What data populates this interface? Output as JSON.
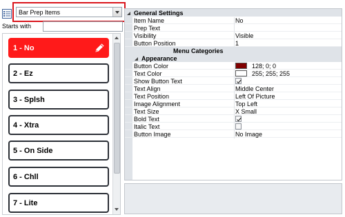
{
  "dropdown": {
    "value": "Bar Prep Items"
  },
  "search": {
    "label": "Starts with",
    "value": ""
  },
  "items": [
    {
      "label": "1 - No",
      "selected": true
    },
    {
      "label": "2 - Ez",
      "selected": false
    },
    {
      "label": "3 - Splsh",
      "selected": false
    },
    {
      "label": "4 - Xtra",
      "selected": false
    },
    {
      "label": "5 - On Side",
      "selected": false
    },
    {
      "label": "6 - Chll",
      "selected": false
    },
    {
      "label": "7 - Lite",
      "selected": false
    }
  ],
  "properties": {
    "general_settings": "General Settings",
    "item_name": {
      "name": "Item Name",
      "value": "No"
    },
    "prep_text": {
      "name": "Prep Text",
      "value": ""
    },
    "visibility": {
      "name": "Visibility",
      "value": "Visible"
    },
    "button_position": {
      "name": "Button Position",
      "value": "1"
    },
    "menu_categories": "Menu Categories",
    "appearance": "Appearance",
    "button_color": {
      "name": "Button Color",
      "value": "128; 0; 0",
      "swatch": "#800000"
    },
    "text_color": {
      "name": "Text Color",
      "value": "255; 255; 255",
      "swatch": "#ffffff"
    },
    "show_button_text": {
      "name": "Show Button Text",
      "checked": true
    },
    "text_align": {
      "name": "Text Align",
      "value": "Middle Center"
    },
    "text_position": {
      "name": "Text Position",
      "value": "Left Of Picture"
    },
    "image_alignment": {
      "name": "Image Alignment",
      "value": "Top Left"
    },
    "text_size": {
      "name": "Text Size",
      "value": "X Small"
    },
    "bold_text": {
      "name": "Bold Text",
      "checked": true
    },
    "italic_text": {
      "name": "Italic Text",
      "checked": false
    },
    "button_image": {
      "name": "Button Image",
      "value": "No Image"
    }
  },
  "colors": {
    "accent_red": "#ff1a1a",
    "highlight_border": "#d9141b",
    "category_bg": "#dfe3e8"
  }
}
